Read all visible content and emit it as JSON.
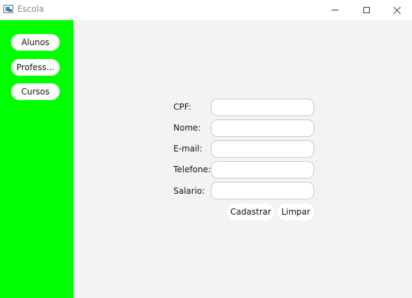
{
  "window": {
    "title": "Escola",
    "controls": [
      "minimize",
      "maximize",
      "close"
    ]
  },
  "colors": {
    "sidebar": "#00ff00",
    "main_background": "#f3f3f3",
    "button_background": "#ffffff"
  },
  "sidebar": {
    "items": [
      {
        "label": "Alunos"
      },
      {
        "label": "Profess..."
      },
      {
        "label": "Cursos"
      }
    ]
  },
  "form": {
    "fields": [
      {
        "label": "CPF:",
        "value": "",
        "placeholder": ""
      },
      {
        "label": "Nome:",
        "value": "",
        "placeholder": ""
      },
      {
        "label": "E-mail:",
        "value": "",
        "placeholder": ""
      },
      {
        "label": "Telefone:",
        "value": "",
        "placeholder": ""
      },
      {
        "label": "Salario:",
        "value": "",
        "placeholder": ""
      }
    ],
    "submit_label": "Cadastrar",
    "clear_label": "Limpar"
  }
}
